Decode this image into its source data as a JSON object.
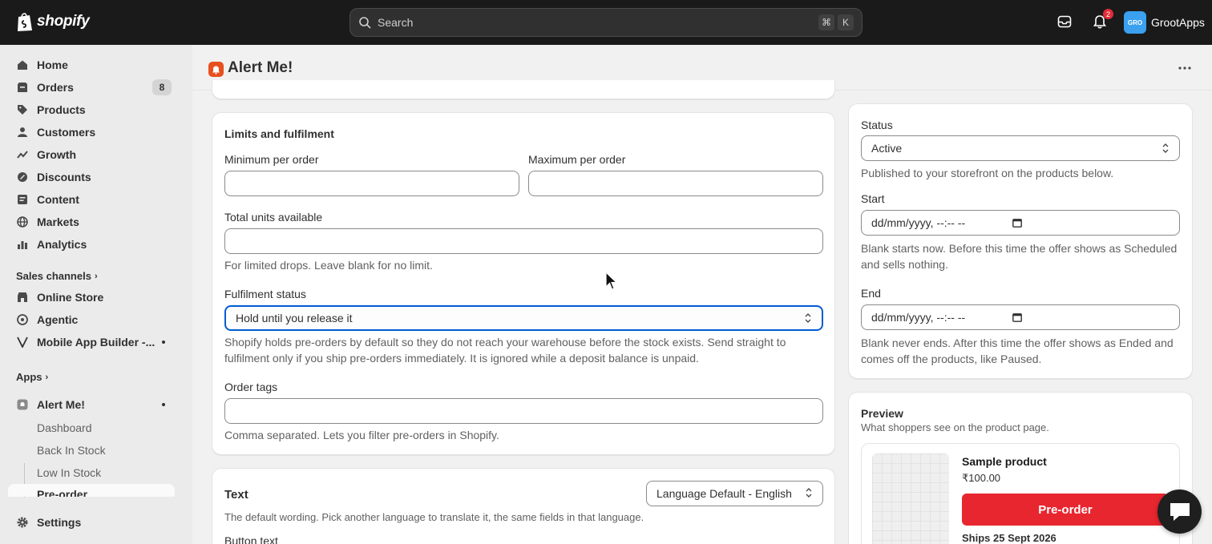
{
  "topbar": {
    "logo_text": "shopify",
    "search_placeholder": "Search",
    "shortcut_keys": [
      "⌘",
      "K"
    ],
    "notification_count": "2",
    "store_avatar": "GRO",
    "store_name": "GrootApps"
  },
  "sidebar": {
    "items": [
      {
        "label": "Home",
        "icon": "home-icon"
      },
      {
        "label": "Orders",
        "icon": "orders-icon",
        "count": "8"
      },
      {
        "label": "Products",
        "icon": "tag-icon"
      },
      {
        "label": "Customers",
        "icon": "person-icon"
      },
      {
        "label": "Growth",
        "icon": "growth-icon"
      },
      {
        "label": "Discounts",
        "icon": "discount-icon"
      },
      {
        "label": "Content",
        "icon": "content-icon"
      },
      {
        "label": "Markets",
        "icon": "globe-icon"
      },
      {
        "label": "Analytics",
        "icon": "chart-icon"
      }
    ],
    "sales_channels_label": "Sales channels",
    "channels": [
      {
        "label": "Online Store"
      },
      {
        "label": "Agentic"
      },
      {
        "label": "Mobile App Builder -..."
      }
    ],
    "apps_label": "Apps",
    "app_name": "Alert Me!",
    "app_sub_items": [
      "Dashboard",
      "Back In Stock",
      "Low In Stock",
      "Pre-order"
    ],
    "settings_label": "Settings"
  },
  "page": {
    "title": "Alert Me!"
  },
  "limits": {
    "title": "Limits and fulfilment",
    "min_label": "Minimum per order",
    "min_value": "",
    "max_label": "Maximum per order",
    "max_value": "",
    "total_label": "Total units available",
    "total_value": "",
    "total_help": "For limited drops. Leave blank for no limit.",
    "fulfilment_label": "Fulfilment status",
    "fulfilment_value": "Hold until you release it",
    "fulfilment_help_1": "Shopify holds pre-orders by default so they do not reach your warehouse before the stock exists. Send straight to",
    "fulfilment_help_2": "fulfilment only if you ship pre-orders immediately. It is ignored while a deposit balance is unpaid.",
    "tags_label": "Order tags",
    "tags_value": "",
    "tags_help": "Comma separated. Lets you filter pre-orders in Shopify."
  },
  "text_card": {
    "title": "Text",
    "language_value": "Language Default - English",
    "help": "The default wording. Pick another language to translate it, the same fields in that language.",
    "button_text_label": "Button text"
  },
  "status_card": {
    "status_label": "Status",
    "status_value": "Active",
    "status_help": "Published to your storefront on the products below.",
    "start_label": "Start",
    "start_value": "dd/mm/yyyy, --:-- --",
    "start_help_1": "Blank starts now. Before this time the offer shows as Scheduled",
    "start_help_2": "and sells nothing.",
    "end_label": "End",
    "end_value": "dd/mm/yyyy, --:-- --",
    "end_help_1": "Blank never ends. After this time the offer shows as Ended and",
    "end_help_2": "comes off the products, like Paused."
  },
  "preview": {
    "title": "Preview",
    "subtitle": "What shoppers see on the product page.",
    "product_name": "Sample product",
    "price": "₹100.00",
    "button_label": "Pre-order",
    "ships": "Ships 25 Sept 2026"
  },
  "colors": {
    "accent_red": "#e8262f",
    "focus_blue": "#005bd3",
    "topbar": "#1a1a1a"
  }
}
